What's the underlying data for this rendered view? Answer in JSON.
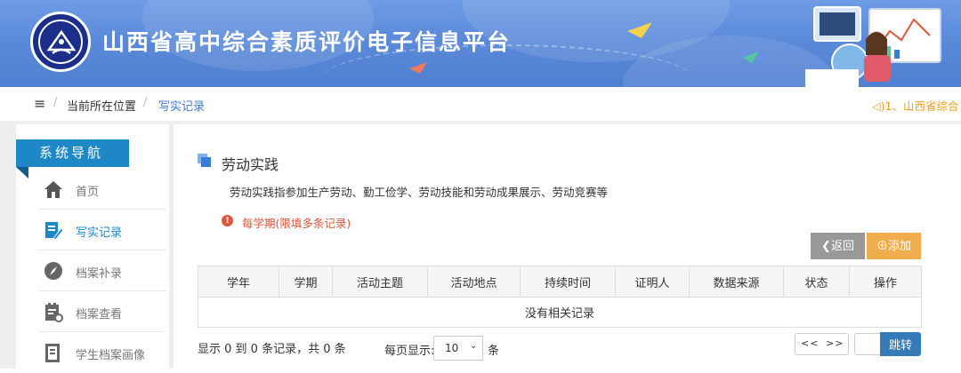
{
  "header": {
    "title": "山西省高中综合素质评价电子信息平台",
    "colors": {
      "banner": "#5b8ad9",
      "logo": "#1b2f8a"
    }
  },
  "breadcrumb": {
    "menu_icon": "≡",
    "sep": "/",
    "location_label": "当前所在位置",
    "current": "写实记录"
  },
  "notice": "◁)1、山西省综合",
  "sidebar": {
    "title": "系统导航",
    "items": [
      {
        "label": "首页",
        "icon": "home-icon",
        "active": false
      },
      {
        "label": "写实记录",
        "icon": "edit-record-icon",
        "active": true
      },
      {
        "label": "档案补录",
        "icon": "compass-icon",
        "active": false
      },
      {
        "label": "档案查看",
        "icon": "archive-view-icon",
        "active": false
      },
      {
        "label": "学生档案画像",
        "icon": "portrait-icon",
        "active": false
      }
    ]
  },
  "main": {
    "section_title": "劳动实践",
    "description": "劳动实践指参加生产劳动、勤工俭学、劳动技能和劳动成果展示、劳动竞赛等",
    "warning_icon": "!",
    "warning": "每学期(限填多条记录)",
    "back_button": "❮返回",
    "add_button": "⊕添加",
    "table": {
      "columns": [
        "学年",
        "学期",
        "活动主题",
        "活动地点",
        "持续时间",
        "证明人",
        "数据来源",
        "状态",
        "操作"
      ],
      "empty_text": "没有相关记录"
    },
    "pagination": {
      "info": "显示 0 到 0 条记录，共 0 条",
      "page_size_label": "每页显示:",
      "page_size": "10",
      "unit": "条",
      "prev": "<<",
      "next": ">>",
      "jump": "跳转"
    }
  },
  "colors": {
    "accent": "#1e88c7",
    "warning": "#e0563b",
    "add": "#f0ad4e",
    "back": "#999999",
    "jump": "#337ab7"
  }
}
